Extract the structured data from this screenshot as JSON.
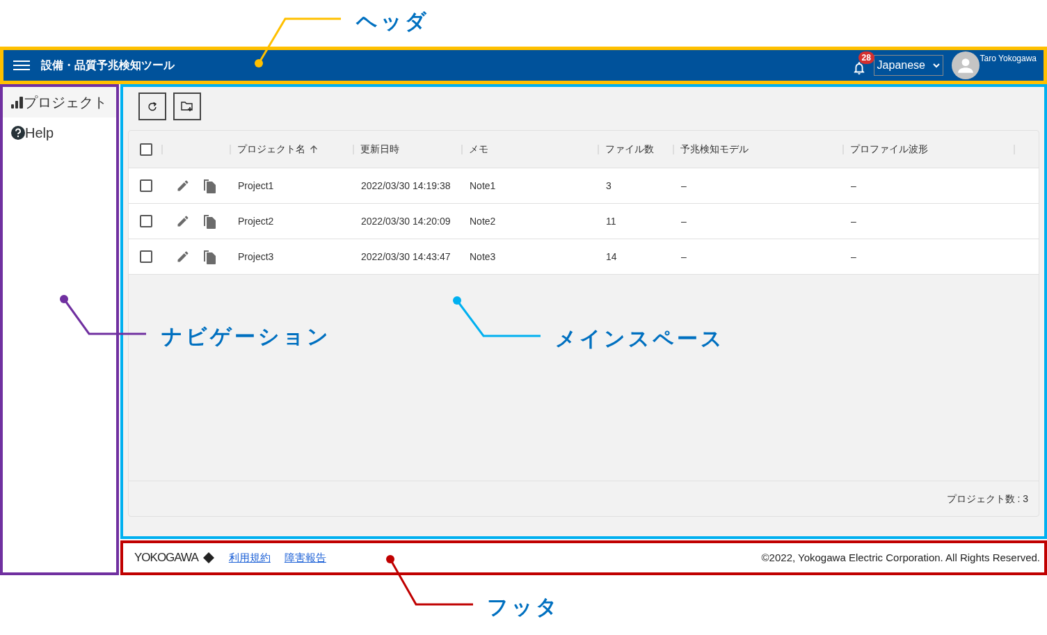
{
  "callouts": [
    {
      "label": "ヘッダ",
      "color": "#ffc000"
    },
    {
      "label": "ナビゲーション",
      "color": "#7030a0"
    },
    {
      "label": "メインスペース",
      "color": "#00b0f0"
    },
    {
      "label": "フッタ",
      "color": "#c00000"
    }
  ],
  "header": {
    "title": "設備・品質予兆検知ツール",
    "notification_count": "28",
    "language": "Japanese",
    "user": "Taro Yokogawa"
  },
  "navigation": {
    "items": [
      {
        "kind": "chart",
        "label": "プロジェクト",
        "selected": true
      },
      {
        "kind": "help",
        "label": "Help",
        "selected": false
      }
    ]
  },
  "main": {
    "table": {
      "select_all_checked": false,
      "columns": [
        {
          "label": "プロジェクト名",
          "sorted": true
        },
        {
          "label": "更新日時",
          "sorted": false
        },
        {
          "label": "メモ",
          "sorted": false
        },
        {
          "label": "ファイル数",
          "sorted": false
        },
        {
          "label": "予兆検知モデル",
          "sorted": false
        },
        {
          "label": "プロファイル波形",
          "sorted": false
        }
      ],
      "rows": [
        {
          "checked": false,
          "cells": [
            "Project1",
            "2022/03/30 14:19:38",
            "Note1",
            "3",
            "–",
            "–"
          ]
        },
        {
          "checked": false,
          "cells": [
            "Project2",
            "2022/03/30 14:20:09",
            "Note2",
            "11",
            "–",
            "–"
          ]
        },
        {
          "checked": false,
          "cells": [
            "Project3",
            "2022/03/30 14:43:47",
            "Note3",
            "14",
            "–",
            "–"
          ]
        }
      ],
      "count": "プロジェクト数 : 3"
    }
  },
  "footer": {
    "logo": "YOKOGAWA",
    "links": [
      "利用規約",
      "障害報告"
    ],
    "copyright": "©2022, Yokogawa Electric Corporation. All Rights Reserved."
  }
}
